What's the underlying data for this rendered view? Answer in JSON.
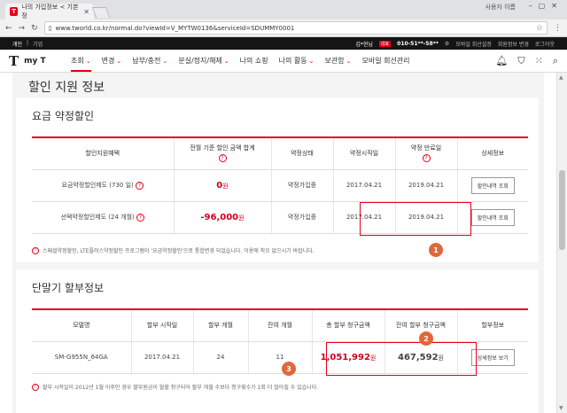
{
  "browser": {
    "tab_title": "나의 가입정보 < 기본정",
    "tab_favicon": "T",
    "window_user": "사용자 이름",
    "url": "www.tworld.co.kr/normal.do?viewId=V_MYTW0136&serviceId=SDUMMY0001"
  },
  "util_bar": {
    "left": [
      "개인",
      "기업"
    ],
    "user_name": "김*현님",
    "user_badge": "대표",
    "phone": "010-51**-58**",
    "links": [
      "모바일 회선설정",
      "회원정보 변경",
      "로그아웃"
    ]
  },
  "gnb": {
    "logo": "my T",
    "menu": [
      {
        "label": "조회",
        "has_dropdown": true,
        "active": true
      },
      {
        "label": "변경",
        "has_dropdown": true
      },
      {
        "label": "납부/충전",
        "has_dropdown": true
      },
      {
        "label": "분실/정지/해제",
        "has_dropdown": true
      },
      {
        "label": "나의 쇼핑",
        "has_dropdown": false
      },
      {
        "label": "나의 활동",
        "has_dropdown": true
      },
      {
        "label": "보관함",
        "has_dropdown": true
      },
      {
        "label": "모바일 회선관리",
        "has_dropdown": false
      }
    ]
  },
  "page": {
    "title": "할인 지원 정보"
  },
  "discount": {
    "title": "요금 약정할인",
    "headers": [
      "할인지원혜택",
      "전월 기준 할인 금액 합계",
      "약정상태",
      "약정시작일",
      "약정 만료일",
      "상세정보"
    ],
    "rows": [
      {
        "benefit": "요금약정할인제도 (730 일)",
        "amount": "0",
        "unit": "원",
        "status": "약정가입중",
        "start": "2017.04.21",
        "end": "2019.04.21",
        "button": "할인내역 조회"
      },
      {
        "benefit": "선택약정할인제도 (24 개월)",
        "amount": "-96,000",
        "unit": "원",
        "status": "약정가입중",
        "start": "2017.04.21",
        "end": "2019.04.21",
        "button": "할인내역 조회"
      }
    ],
    "note": "스페셜약정할인, LTE플러스약정할인 프로그램이 '요금약정할인'으로 통합변경 되었습니다. 이용에 착오 없으시기 바랍니다."
  },
  "installment": {
    "title": "단말기 할부정보",
    "headers": [
      "모델명",
      "할부 시작일",
      "할부 개월",
      "잔여 개월",
      "총 할부 청구금액",
      "잔여 할부 청구금액",
      "할부정보"
    ],
    "rows": [
      {
        "model": "SM-G955N_64GA",
        "start": "2017.04.21",
        "months": "24",
        "remaining": "11",
        "total": "1,051,992",
        "total_unit": "원",
        "remain_amount": "467,592",
        "remain_unit": "원",
        "button": "상세정보 보기"
      }
    ],
    "note": "할부 시작일이 2012년 1월 이후인 경우 할부원금이 월할 청구되어 할부 개월 수보다 청구횟수가 1회 더 많아질 수 있습니다."
  },
  "annotations": [
    "1",
    "2",
    "3"
  ],
  "colors": {
    "accent": "#e3001b",
    "badge": "#e0683d"
  }
}
